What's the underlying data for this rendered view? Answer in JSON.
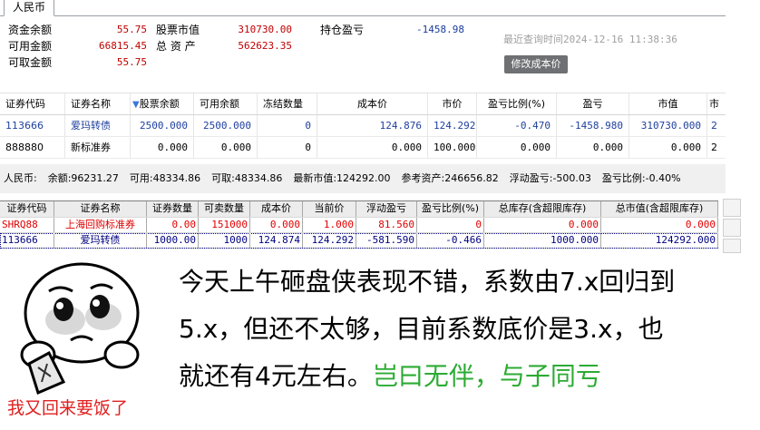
{
  "panel1": {
    "tab_label": "人民币",
    "summary": {
      "cash_balance_label": "资金余额",
      "cash_balance": "55.75",
      "available_label": "可用金额",
      "available": "66815.45",
      "withdrawable_label": "可取金额",
      "withdrawable": "55.75",
      "stock_value_label": "股票市值",
      "stock_value": "310730.00",
      "total_assets_label": "总 资 产",
      "total_assets": "562623.35",
      "position_pnl_label": "持仓盈亏",
      "position_pnl": "-1458.98"
    },
    "query_time_label": "最近查询时间",
    "query_time": "2024-12-16 11:38:36",
    "modify_cost_button": "修改成本价",
    "columns": [
      "证券代码",
      "证券名称",
      "股票余额",
      "可用余额",
      "冻结数量",
      "成本价",
      "市价",
      "盈亏比例(%)",
      "盈亏",
      "市值",
      "市"
    ],
    "rows": [
      [
        "113666",
        "爱玛转债",
        "2500.000",
        "2500.000",
        "0",
        "124.876",
        "124.292",
        "-0.470",
        "-1458.980",
        "310730.000",
        "2"
      ],
      [
        "888880",
        "新标准券",
        "0.000",
        "0.000",
        "0",
        "0.000",
        "100.000",
        "0.000",
        "0.000",
        "0.000",
        "2"
      ]
    ],
    "sort_indicator_icon": "sort-down-triangle-icon"
  },
  "panel2": {
    "summary_bar": {
      "currency": "人民币:",
      "balance": "余额:96231.27",
      "available": "可用:48334.86",
      "withdrawable": "可取:48334.86",
      "latest_mv": "最新市值:124292.00",
      "ref_assets": "参考资产:246656.82",
      "floating_pnl": "浮动盈亏:-500.03",
      "pnl_ratio": "盈亏比例:-0.40%"
    },
    "columns": [
      "证券代码",
      "证券名称",
      "证券数量",
      "可卖数量",
      "成本价",
      "当前价",
      "浮动盈亏",
      "盈亏比例(%)",
      "总库存(含超限库存)",
      "总市值(含超限库存)"
    ],
    "rows": [
      [
        "SHRQ88",
        "上海回购标准券",
        "0.00",
        "151000",
        "0.000",
        "1.000",
        "81.560",
        "0",
        "0.000",
        "0.000"
      ],
      [
        "113666",
        "爱玛转债",
        "1000.00",
        "1000",
        "124.874",
        "124.292",
        "-581.590",
        "-0.466",
        "1000.000",
        "124292.000"
      ]
    ]
  },
  "meme": {
    "caption": "我又回来要饭了",
    "comment_line1": "今天上午砸盘侠表现不错，系数由7.x回归到",
    "comment_line2": "5.x，但还不太够，目前系数底价是3.x，也",
    "comment_line3": "就还有4元左右。",
    "comment_green": "岂曰无伴，与子同亏",
    "face_icon": "crying-beggar-face-icon",
    "colors": {
      "caption": "#e02020",
      "green": "#2cab33"
    }
  },
  "colors": {
    "value_red": "#c00000",
    "blue_text": "#2040a0",
    "row_red": "#e00000",
    "row_navy": "#000080",
    "button_gray": "#6e7073"
  }
}
